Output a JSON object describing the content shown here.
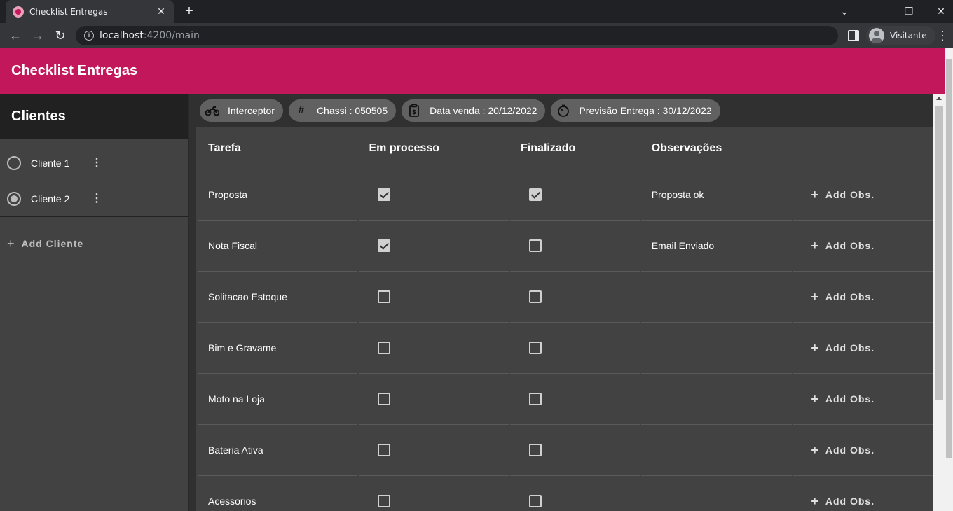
{
  "browser": {
    "tab_title": "Checklist Entregas",
    "url_host": "localhost",
    "url_path": ":4200/main",
    "profile_name": "Visitante"
  },
  "app": {
    "title": "Checklist Entregas"
  },
  "sidebar": {
    "header": "Clientes",
    "clients": [
      {
        "name": "Cliente 1",
        "selected": false
      },
      {
        "name": "Cliente 2",
        "selected": true
      }
    ],
    "add_label": "Add Cliente"
  },
  "chips": [
    {
      "icon": "motorcycle-icon",
      "text": "Interceptor"
    },
    {
      "icon": "hashtag-icon",
      "text": "Chassi : 050505"
    },
    {
      "icon": "receipt-icon",
      "text": "Data venda : 20/12/2022"
    },
    {
      "icon": "timer-icon",
      "text": "Previsão Entrega : 30/12/2022"
    }
  ],
  "table": {
    "headers": [
      "Tarefa",
      "Em processo",
      "Finalizado",
      "Observações",
      ""
    ],
    "add_obs_label": "Add Obs.",
    "rows": [
      {
        "tarefa": "Proposta",
        "em_processo": true,
        "finalizado": true,
        "obs": "Proposta ok"
      },
      {
        "tarefa": "Nota Fiscal",
        "em_processo": true,
        "finalizado": false,
        "obs": "Email Enviado"
      },
      {
        "tarefa": "Solitacao Estoque",
        "em_processo": false,
        "finalizado": false,
        "obs": ""
      },
      {
        "tarefa": "Bim e Gravame",
        "em_processo": false,
        "finalizado": false,
        "obs": ""
      },
      {
        "tarefa": "Moto na Loja",
        "em_processo": false,
        "finalizado": false,
        "obs": ""
      },
      {
        "tarefa": "Bateria Ativa",
        "em_processo": false,
        "finalizado": false,
        "obs": ""
      },
      {
        "tarefa": "Acessorios",
        "em_processo": false,
        "finalizado": false,
        "obs": ""
      }
    ]
  },
  "colors": {
    "primary": "#c2185b",
    "background": "#303030",
    "surface": "#424242"
  }
}
